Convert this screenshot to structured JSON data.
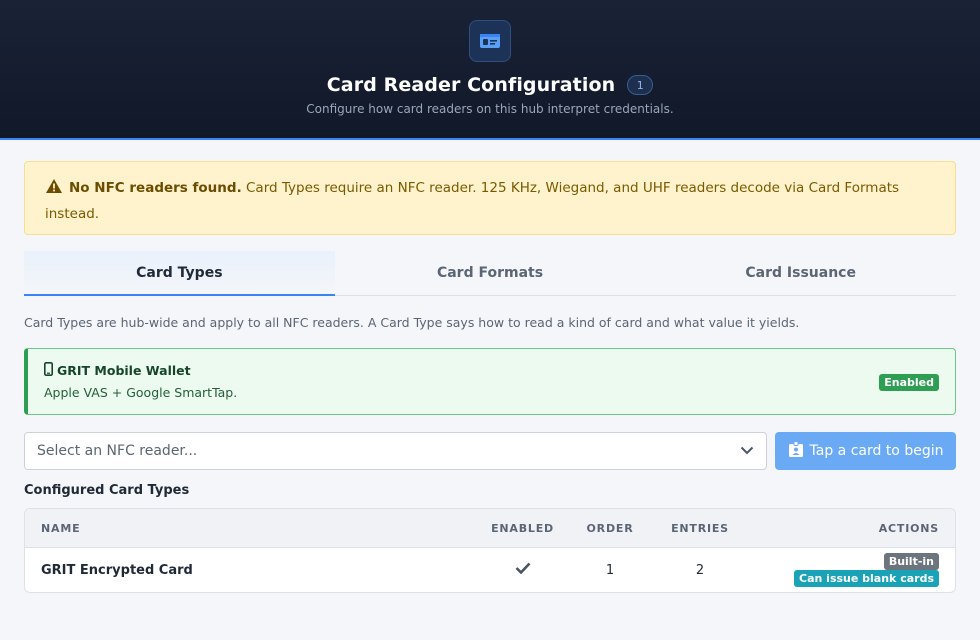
{
  "header": {
    "icon": "id-card-icon",
    "title": "Card Reader Configuration",
    "count": "1",
    "subtitle": "Configure how card readers on this hub interpret credentials."
  },
  "alert": {
    "icon": "warning-icon",
    "strong": "No NFC readers found.",
    "message": " Card Types require an NFC reader. 125 KHz, Wiegand, and UHF readers decode via Card Formats instead."
  },
  "tabs": [
    {
      "label": "Card Types",
      "active": true
    },
    {
      "label": "Card Formats",
      "active": false
    },
    {
      "label": "Card Issuance",
      "active": false
    }
  ],
  "description": "Card Types are hub-wide and apply to all NFC readers. A Card Type says how to read a kind of card and what value it yields.",
  "wallet": {
    "icon": "phone-icon",
    "title": "GRIT Mobile Wallet",
    "subtitle": "Apple VAS + Google SmartTap.",
    "badge": "Enabled"
  },
  "reader": {
    "placeholder": "Select an NFC reader...",
    "button": "Tap a card to begin"
  },
  "section_title": "Configured Card Types",
  "table": {
    "headers": {
      "name": "NAME",
      "enabled": "ENABLED",
      "order": "ORDER",
      "entries": "ENTRIES",
      "actions": "ACTIONS"
    },
    "rows": [
      {
        "name": "GRIT Encrypted Card",
        "enabled": true,
        "order": "1",
        "entries": "2",
        "tags": [
          "Built-in",
          "Can issue blank cards"
        ]
      }
    ]
  },
  "colors": {
    "accent": "#3b82f6",
    "success": "#2e9e53",
    "warning_bg": "#fff3cd",
    "teal": "#1aa3b6"
  }
}
